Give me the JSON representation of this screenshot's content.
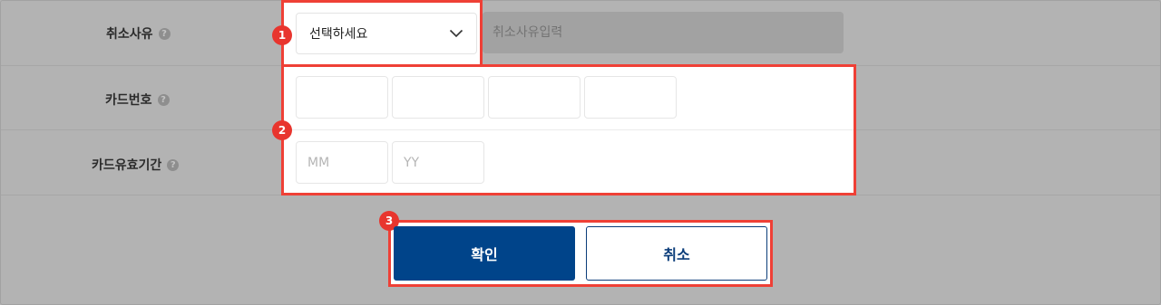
{
  "form": {
    "cancel_reason": {
      "label": "취소사유",
      "help": "?",
      "select_value": "선택하세요",
      "input_placeholder": "취소사유입력"
    },
    "card_number": {
      "label": "카드번호",
      "help": "?",
      "fields": [
        "",
        "",
        "",
        ""
      ]
    },
    "card_expiry": {
      "label": "카드유효기간",
      "help": "?",
      "month_placeholder": "MM",
      "year_placeholder": "YY"
    }
  },
  "buttons": {
    "confirm": "확인",
    "cancel": "취소"
  },
  "annotations": {
    "badge_1": "1",
    "badge_2": "2",
    "badge_3": "3",
    "color": "#ef4036"
  },
  "colors": {
    "confirm_bg": "#00448a",
    "background": "#b3b3b3"
  }
}
